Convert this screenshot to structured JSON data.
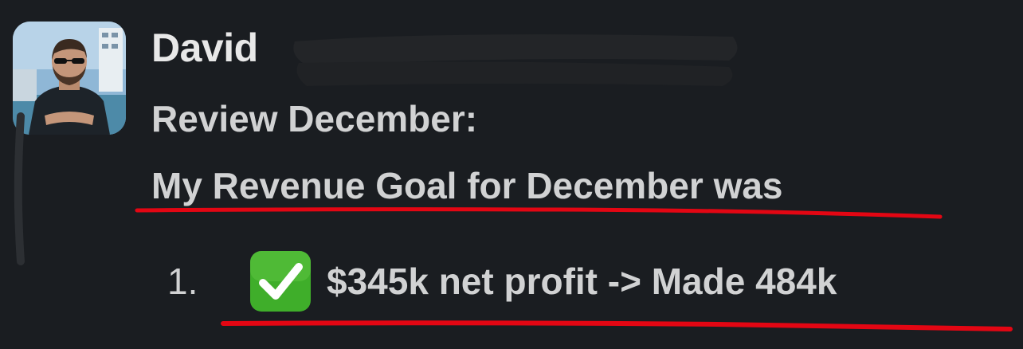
{
  "message": {
    "author": "David",
    "lines": [
      "Review December:",
      "My Revenue Goal for December was"
    ],
    "list": [
      {
        "number": "1.",
        "icon": "check-mark-button-icon",
        "text": "$345k net profit -> Made 484k"
      }
    ]
  },
  "colors": {
    "background": "#1a1d21",
    "text": "#d1d2d3",
    "underline": "#e30613",
    "check_emoji": "#3fae2a"
  }
}
